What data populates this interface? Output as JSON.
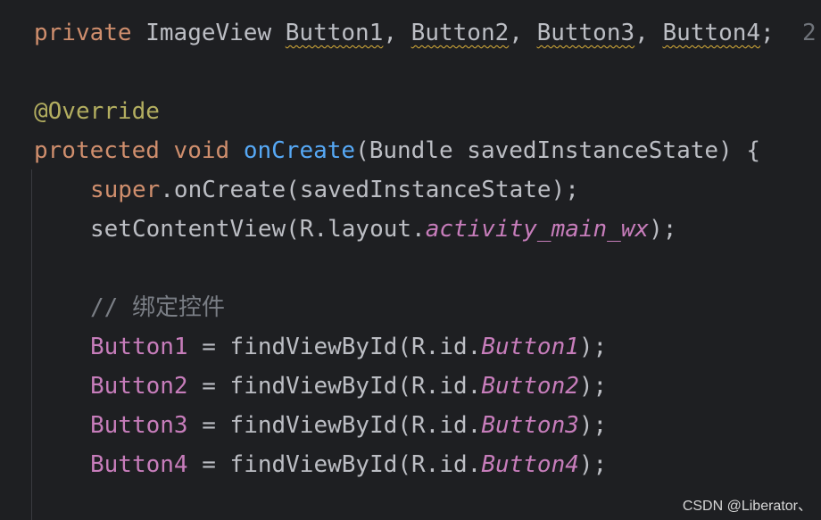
{
  "code": {
    "l1": {
      "kw": "private",
      "type": "ImageView",
      "v1": "Button1",
      "v2": "Button2",
      "v3": "Button3",
      "v4": "Button4",
      "sep": ", ",
      "end": ";",
      "overflow": "2"
    },
    "l2": {
      "anno": "@Override"
    },
    "l3": {
      "kw1": "protected",
      "kw2": "void",
      "method": "onCreate",
      "params": "(Bundle savedInstanceState) {"
    },
    "l4": {
      "kw": "super",
      "rest": ".onCreate(savedInstanceState);"
    },
    "l5": {
      "pre": "setContentView(R.layout.",
      "ital": "activity_main_wx",
      "post": ");"
    },
    "l6": {
      "comment": "// 绑定控件"
    },
    "assignments": [
      {
        "var": "Button1",
        "mid": " = findViewById(R.id.",
        "id": "Button1",
        "end": ");"
      },
      {
        "var": "Button2",
        "mid": " = findViewById(R.id.",
        "id": "Button2",
        "end": ");"
      },
      {
        "var": "Button3",
        "mid": " = findViewById(R.id.",
        "id": "Button3",
        "end": ");"
      },
      {
        "var": "Button4",
        "mid": " = findViewById(R.id.",
        "id": "Button4",
        "end": ");"
      }
    ]
  },
  "watermark": "CSDN @Liberator、",
  "colors": {
    "background": "#1e1f22",
    "keyword": "#cf8e6d",
    "field": "#c77dbb",
    "method": "#56a8f5",
    "annotation": "#b3ae60",
    "comment": "#7a7e85",
    "text": "#bcbec4"
  }
}
